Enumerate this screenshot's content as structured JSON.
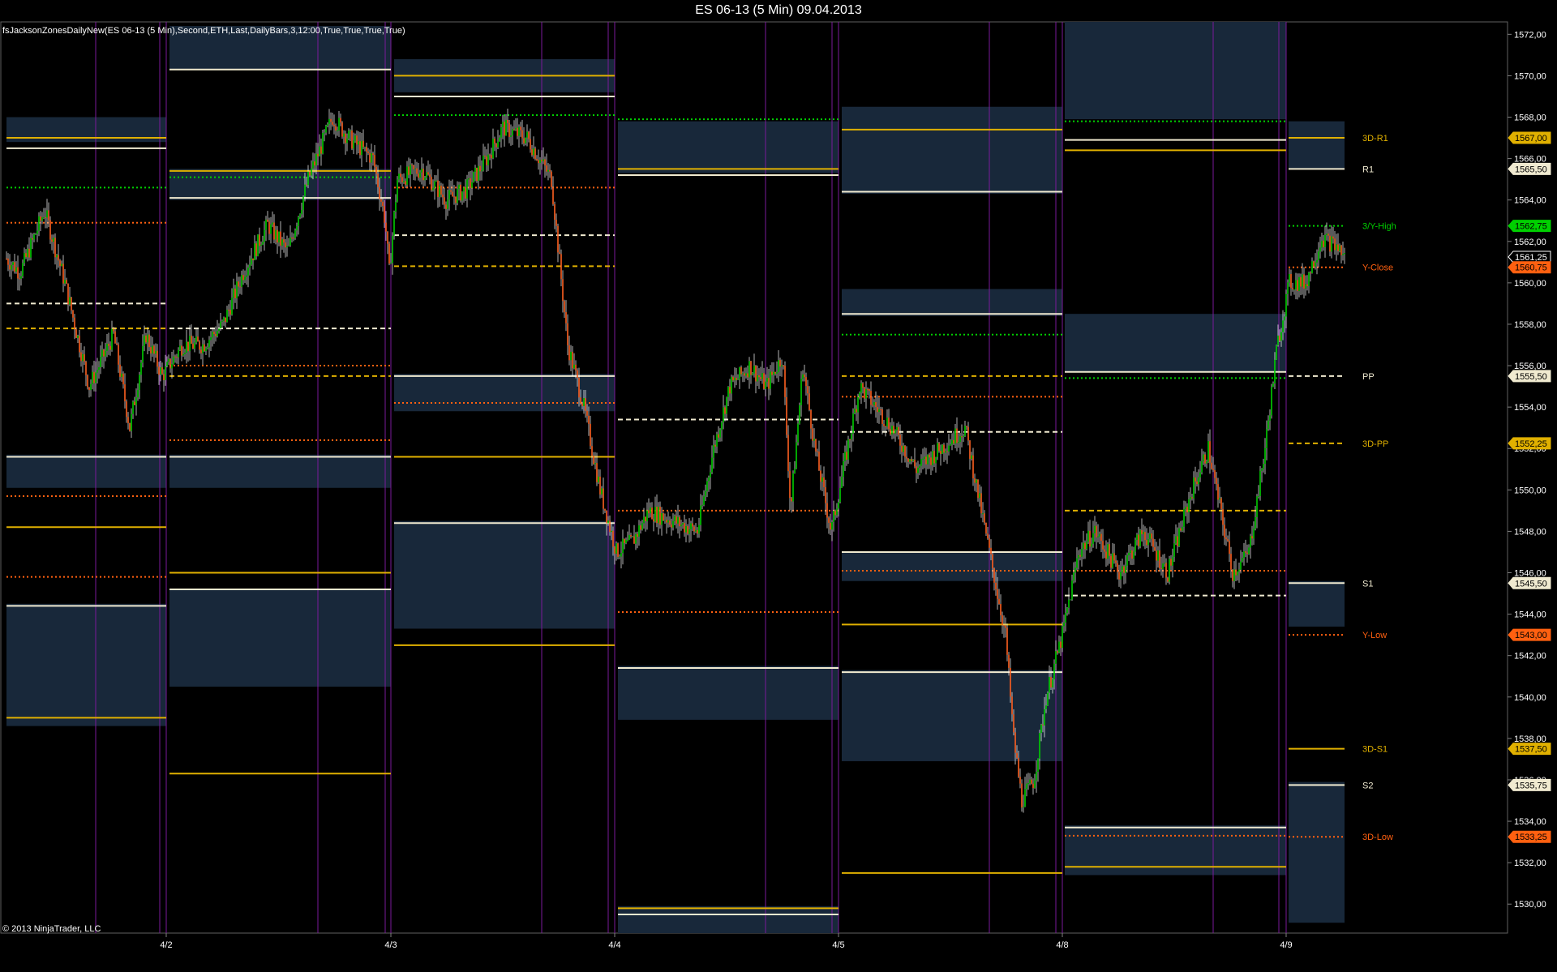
{
  "window": {
    "title": "ES 06-13 (5 Min)  09.04.2013"
  },
  "indicator_label": "fsJacksonZonesDailyNew(ES 06-13 (5 Min),Second,ETH,Last,DailyBars,3,12:00,True,True,True,True)",
  "copyright": "© 2013 NinjaTrader, LLC",
  "chart_data": {
    "type": "candlestick",
    "y_ticks": [
      "1530,00",
      "1532,00",
      "1534,00",
      "1536,00",
      "1538,00",
      "1540,00",
      "1542,00",
      "1544,00",
      "1546,00",
      "1548,00",
      "1550,00",
      "1552,00",
      "1554,00",
      "1556,00",
      "1558,00",
      "1560,00",
      "1562,00",
      "1564,00",
      "1566,00",
      "1568,00",
      "1570,00",
      "1572,00"
    ],
    "ylim": [
      1528.6,
      1572.6
    ],
    "x_ticks": [
      "4/2",
      "4/3",
      "4/4",
      "4/5",
      "4/8",
      "4/9"
    ],
    "colors": {
      "up_candle": "#00d000",
      "down_candle": "#ff6020",
      "wick": "#ffffff",
      "zone_fill": "#18283a",
      "session_divider": "#7a1a9a",
      "level_white": "#f0ead0",
      "level_gold": "#e0b000",
      "level_green": "#00d000",
      "level_orange": "#ff6010"
    },
    "price_path": [
      [
        0,
        1561.5
      ],
      [
        25,
        1560.5
      ],
      [
        55,
        1563.5
      ],
      [
        80,
        1560
      ],
      [
        110,
        1555
      ],
      [
        140,
        1557.5
      ],
      [
        160,
        1553
      ],
      [
        180,
        1557.5
      ],
      [
        200,
        1555.5
      ],
      [
        225,
        1557
      ],
      [
        250,
        1557
      ],
      [
        275,
        1558
      ],
      [
        300,
        1560.5
      ],
      [
        330,
        1562.8
      ],
      [
        355,
        1561.5
      ],
      [
        380,
        1565
      ],
      [
        410,
        1568
      ],
      [
        430,
        1567
      ],
      [
        460,
        1566
      ],
      [
        475,
        1563
      ],
      [
        480,
        1560.5
      ],
      [
        490,
        1565
      ],
      [
        520,
        1565.5
      ],
      [
        550,
        1564
      ],
      [
        575,
        1564.5
      ],
      [
        600,
        1566
      ],
      [
        620,
        1567.5
      ],
      [
        650,
        1567
      ],
      [
        680,
        1565
      ],
      [
        700,
        1557
      ],
      [
        720,
        1554
      ],
      [
        740,
        1550
      ],
      [
        760,
        1547
      ],
      [
        780,
        1547.5
      ],
      [
        800,
        1549
      ],
      [
        830,
        1548.5
      ],
      [
        860,
        1548
      ],
      [
        880,
        1552
      ],
      [
        900,
        1555
      ],
      [
        925,
        1556
      ],
      [
        945,
        1555
      ],
      [
        965,
        1556.5
      ],
      [
        975,
        1549
      ],
      [
        990,
        1556
      ],
      [
        1005,
        1552
      ],
      [
        1025,
        1548
      ],
      [
        1045,
        1552
      ],
      [
        1060,
        1555
      ],
      [
        1080,
        1554
      ],
      [
        1100,
        1553
      ],
      [
        1130,
        1551
      ],
      [
        1160,
        1552
      ],
      [
        1190,
        1553
      ],
      [
        1210,
        1549
      ],
      [
        1225,
        1546
      ],
      [
        1240,
        1543
      ],
      [
        1250,
        1538
      ],
      [
        1260,
        1535
      ],
      [
        1275,
        1536
      ],
      [
        1290,
        1540
      ],
      [
        1310,
        1543
      ],
      [
        1330,
        1547
      ],
      [
        1350,
        1548
      ],
      [
        1380,
        1546
      ],
      [
        1410,
        1548
      ],
      [
        1440,
        1546
      ],
      [
        1470,
        1550
      ],
      [
        1490,
        1552
      ],
      [
        1505,
        1549
      ],
      [
        1520,
        1546
      ],
      [
        1540,
        1547
      ],
      [
        1560,
        1552
      ],
      [
        1575,
        1557
      ],
      [
        1590,
        1560
      ],
      [
        1610,
        1560
      ],
      [
        1630,
        1562.2
      ],
      [
        1650,
        1561.7
      ],
      [
        1659,
        1561.2
      ]
    ],
    "right_labels": [
      {
        "text": "3D-R1",
        "price": 1567.0,
        "color": "#e0b000"
      },
      {
        "text": "R1",
        "price": 1565.5,
        "color": "#f0ead0"
      },
      {
        "text": "3/Y-High",
        "price": 1562.75,
        "color": "#00d000"
      },
      {
        "text": "Y-Close",
        "price": 1560.75,
        "color": "#ff6010"
      },
      {
        "text": "PP",
        "price": 1555.5,
        "color": "#f0ead0"
      },
      {
        "text": "3D-PP",
        "price": 1552.25,
        "color": "#e0b000"
      },
      {
        "text": "S1",
        "price": 1545.5,
        "color": "#f0ead0"
      },
      {
        "text": "Y-Low",
        "price": 1543.0,
        "color": "#ff6010"
      },
      {
        "text": "3D-S1",
        "price": 1537.5,
        "color": "#e0b000"
      },
      {
        "text": "S2",
        "price": 1535.75,
        "color": "#f0ead0"
      },
      {
        "text": "3D-Low",
        "price": 1533.25,
        "color": "#ff6010"
      }
    ],
    "price_markers": [
      {
        "text": "1567,00",
        "price": 1567.0,
        "bg": "#e0b000",
        "fg": "#000"
      },
      {
        "text": "1565,50",
        "price": 1565.5,
        "bg": "#f0ead0",
        "fg": "#000"
      },
      {
        "text": "1562,75",
        "price": 1562.75,
        "bg": "#00d000",
        "fg": "#000"
      },
      {
        "text": "1561,25",
        "price": 1561.25,
        "bg": "#000",
        "fg": "#fff"
      },
      {
        "text": "1560,75",
        "price": 1560.75,
        "bg": "#ff6010",
        "fg": "#000"
      },
      {
        "text": "1555,50",
        "price": 1555.5,
        "bg": "#f0ead0",
        "fg": "#000"
      },
      {
        "text": "1552,25",
        "price": 1552.25,
        "bg": "#e0b000",
        "fg": "#000"
      },
      {
        "text": "1545,50",
        "price": 1545.5,
        "bg": "#f0ead0",
        "fg": "#000"
      },
      {
        "text": "1543,00",
        "price": 1543.0,
        "bg": "#ff6010",
        "fg": "#000"
      },
      {
        "text": "1537,50",
        "price": 1537.5,
        "bg": "#e0b000",
        "fg": "#000"
      },
      {
        "text": "1535,75",
        "price": 1535.75,
        "bg": "#f0ead0",
        "fg": "#000"
      },
      {
        "text": "1533,25",
        "price": 1533.25,
        "bg": "#ff6010",
        "fg": "#000"
      }
    ],
    "sessions": [
      {
        "from": 8,
        "to": 205,
        "zones": [
          [
            1568,
            1566.8
          ],
          [
            1551.7,
            1550.1
          ],
          [
            1544.5,
            1538.6
          ]
        ],
        "levels": [
          [
            1567,
            "gold",
            "solid"
          ],
          [
            1566.5,
            "white",
            "solid"
          ],
          [
            1564.6,
            "green",
            "dot"
          ],
          [
            1562.9,
            "orange",
            "dot"
          ],
          [
            1559,
            "white",
            "dash"
          ],
          [
            1557.8,
            "gold",
            "dash"
          ],
          [
            1551.6,
            "white",
            "solid"
          ],
          [
            1549.7,
            "orange",
            "dot"
          ],
          [
            1548.2,
            "gold",
            "solid"
          ],
          [
            1545.8,
            "orange",
            "dot"
          ],
          [
            1544.4,
            "white",
            "solid"
          ],
          [
            1539,
            "gold",
            "solid"
          ]
        ]
      },
      {
        "from": 209,
        "to": 482,
        "zones": [
          [
            1572.4,
            1570.3
          ],
          [
            1565.5,
            1564
          ],
          [
            1551.7,
            1550.1
          ],
          [
            1545.2,
            1540.5
          ]
        ],
        "levels": [
          [
            1570.3,
            "white",
            "solid"
          ],
          [
            1565.4,
            "gold",
            "solid"
          ],
          [
            1565.1,
            "green",
            "dot"
          ],
          [
            1564.1,
            "white",
            "solid"
          ],
          [
            1557.8,
            "white",
            "dash"
          ],
          [
            1556,
            "orange",
            "dot"
          ],
          [
            1555.5,
            "gold",
            "dash"
          ],
          [
            1552.4,
            "orange",
            "dot"
          ],
          [
            1551.6,
            "white",
            "solid"
          ],
          [
            1546,
            "gold",
            "solid"
          ],
          [
            1545.2,
            "white",
            "solid"
          ],
          [
            1536.3,
            "gold",
            "solid"
          ]
        ]
      },
      {
        "from": 486,
        "to": 758,
        "zones": [
          [
            1570.8,
            1569.2
          ],
          [
            1555.6,
            1553.8
          ],
          [
            1548.5,
            1543.3
          ]
        ],
        "levels": [
          [
            1570,
            "gold",
            "solid"
          ],
          [
            1569,
            "white",
            "solid"
          ],
          [
            1568.1,
            "green",
            "dot"
          ],
          [
            1564.6,
            "orange",
            "dot"
          ],
          [
            1562.3,
            "white",
            "dash"
          ],
          [
            1560.8,
            "gold",
            "dash"
          ],
          [
            1555.5,
            "white",
            "solid"
          ],
          [
            1554.2,
            "orange",
            "dot"
          ],
          [
            1551.6,
            "gold",
            "solid"
          ],
          [
            1548.4,
            "white",
            "solid"
          ],
          [
            1542.5,
            "gold",
            "solid"
          ]
        ]
      },
      {
        "from": 762,
        "to": 1034,
        "zones": [
          [
            1567.8,
            1565.3
          ],
          [
            1541.5,
            1538.9
          ],
          [
            1529.9,
            1528.6
          ]
        ],
        "levels": [
          [
            1567.9,
            "green",
            "dot"
          ],
          [
            1565.5,
            "gold",
            "solid"
          ],
          [
            1565.2,
            "white",
            "solid"
          ],
          [
            1553.4,
            "white",
            "dash"
          ],
          [
            1549,
            "orange",
            "dot"
          ],
          [
            1544.1,
            "orange",
            "dot"
          ],
          [
            1541.4,
            "white",
            "solid"
          ],
          [
            1529.8,
            "gold",
            "solid"
          ],
          [
            1529.5,
            "white",
            "solid"
          ]
        ]
      },
      {
        "from": 1038,
        "to": 1310,
        "zones": [
          [
            1568.5,
            1564.3
          ],
          [
            1559.7,
            1558.4
          ],
          [
            1547,
            1545.6
          ],
          [
            1541.3,
            1536.9
          ]
        ],
        "levels": [
          [
            1567.4,
            "gold",
            "solid"
          ],
          [
            1564.4,
            "white",
            "solid"
          ],
          [
            1558.5,
            "white",
            "solid"
          ],
          [
            1557.5,
            "green",
            "dot"
          ],
          [
            1555.5,
            "gold",
            "dash"
          ],
          [
            1554.5,
            "orange",
            "dot"
          ],
          [
            1552.8,
            "white",
            "dash"
          ],
          [
            1547,
            "white",
            "solid"
          ],
          [
            1546.1,
            "orange",
            "dot"
          ],
          [
            1543.5,
            "gold",
            "solid"
          ],
          [
            1541.2,
            "white",
            "solid"
          ],
          [
            1531.5,
            "gold",
            "solid"
          ]
        ]
      },
      {
        "from": 1313,
        "to": 1586,
        "zones": [
          [
            1572.6,
            1567.9
          ],
          [
            1558.5,
            1555.7
          ],
          [
            1533.8,
            1531.4
          ]
        ],
        "levels": [
          [
            1567.8,
            "green",
            "dot"
          ],
          [
            1566.9,
            "white",
            "solid"
          ],
          [
            1566.4,
            "gold",
            "solid"
          ],
          [
            1555.7,
            "white",
            "solid"
          ],
          [
            1555.4,
            "green",
            "dot"
          ],
          [
            1549,
            "gold",
            "dash"
          ],
          [
            1546.1,
            "orange",
            "dot"
          ],
          [
            1544.9,
            "white",
            "dash"
          ],
          [
            1533.7,
            "white",
            "solid"
          ],
          [
            1533.3,
            "orange",
            "dot"
          ],
          [
            1531.8,
            "gold",
            "solid"
          ]
        ]
      },
      {
        "from": 1589,
        "to": 1658,
        "zones": [
          [
            1567.8,
            1565.5
          ],
          [
            1545.6,
            1543.4
          ],
          [
            1535.9,
            1529.1
          ]
        ],
        "levels": [
          [
            1567,
            "gold",
            "solid"
          ],
          [
            1565.5,
            "white",
            "solid"
          ],
          [
            1562.75,
            "green",
            "dot"
          ],
          [
            1560.75,
            "orange",
            "dot"
          ],
          [
            1555.5,
            "white",
            "dash"
          ],
          [
            1552.25,
            "gold",
            "dash"
          ],
          [
            1545.5,
            "white",
            "solid"
          ],
          [
            1543,
            "orange",
            "dot"
          ],
          [
            1537.5,
            "gold",
            "solid"
          ],
          [
            1535.75,
            "white",
            "solid"
          ],
          [
            1533.25,
            "orange",
            "dot"
          ]
        ]
      }
    ],
    "dividers": [
      118,
      197,
      205,
      392,
      475,
      482,
      668,
      750,
      758,
      944,
      1026,
      1034,
      1220,
      1302,
      1310,
      1496,
      1577,
      1586
    ]
  }
}
